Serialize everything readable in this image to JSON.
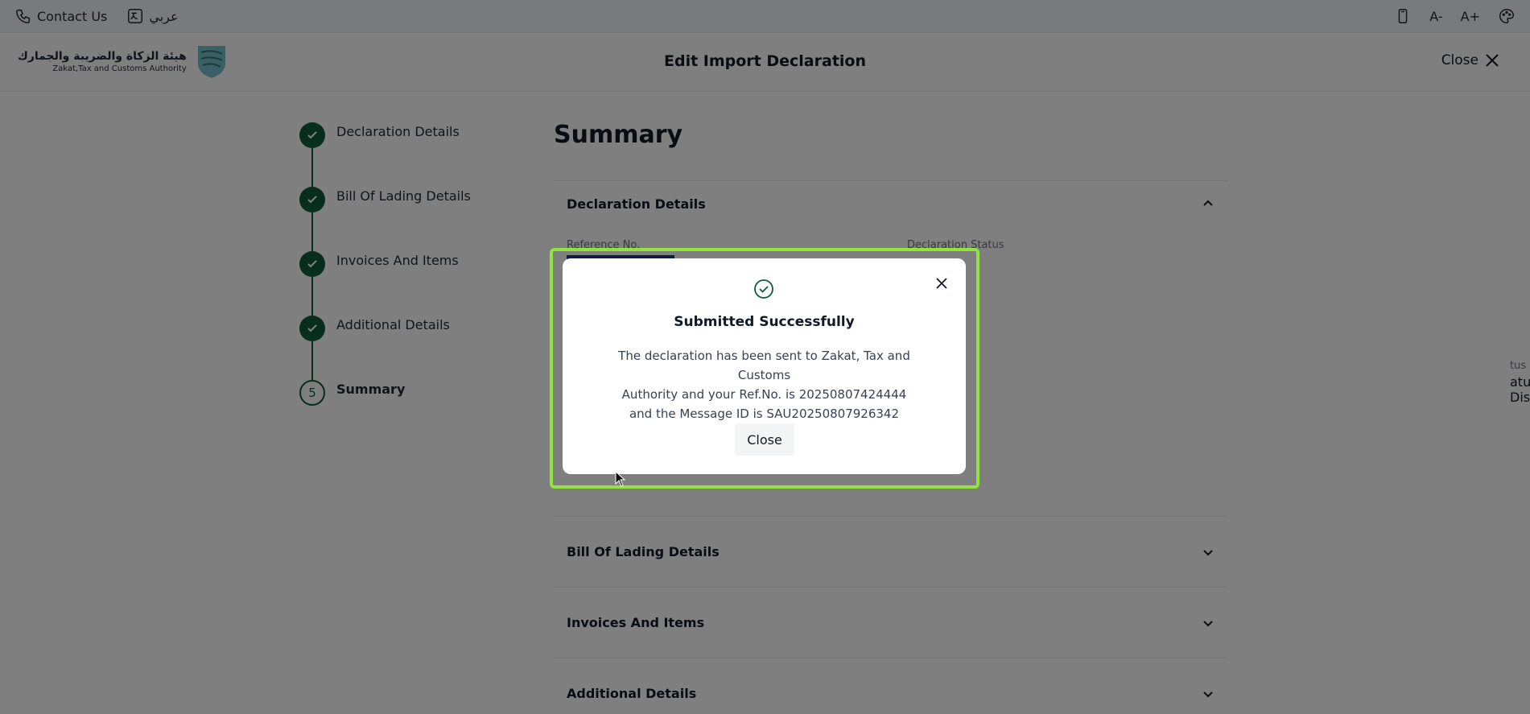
{
  "topbar": {
    "contact_label": "Contact Us",
    "language_label": "عربي",
    "font_decrease_label": "A-",
    "font_increase_label": "A+"
  },
  "header": {
    "logo_ar": "هيئة الزكاة والضريبة والجمارك",
    "logo_en": "Zakat,Tax and Customs Authority",
    "title": "Edit Import Declaration",
    "close_label": "Close"
  },
  "stepper": {
    "steps": [
      {
        "label": "Declaration Details",
        "status": "done"
      },
      {
        "label": "Bill Of Lading Details",
        "status": "done"
      },
      {
        "label": "Invoices And Items",
        "status": "done"
      },
      {
        "label": "Additional Details",
        "status": "done"
      },
      {
        "label": "Summary",
        "status": "current",
        "number": "5"
      }
    ]
  },
  "summary": {
    "title": "Summary",
    "sections": [
      {
        "label": "Declaration Details",
        "expanded": true
      },
      {
        "label": "Bill Of Lading Details",
        "expanded": false
      },
      {
        "label": "Invoices And Items",
        "expanded": false
      },
      {
        "label": "Additional Details",
        "expanded": false
      }
    ],
    "fields": {
      "reference_label": "Reference No.",
      "status_label": "Declaration Status",
      "partial_status_label": "tus",
      "partial_status_value": "atus Disabled"
    }
  },
  "modal": {
    "title": "Submitted Successfully",
    "message_line1": "The declaration has been sent to Zakat, Tax and Customs",
    "message_line2": "Authority and your Ref.No. is 20250807424444",
    "message_line3": "and the Message ID is SAU20250807926342",
    "close_button": "Close"
  },
  "colors": {
    "brand_green": "#0f5c3a",
    "focus_ring": "#8fe53d",
    "overlay": "rgba(0,0,0,0.5)"
  }
}
